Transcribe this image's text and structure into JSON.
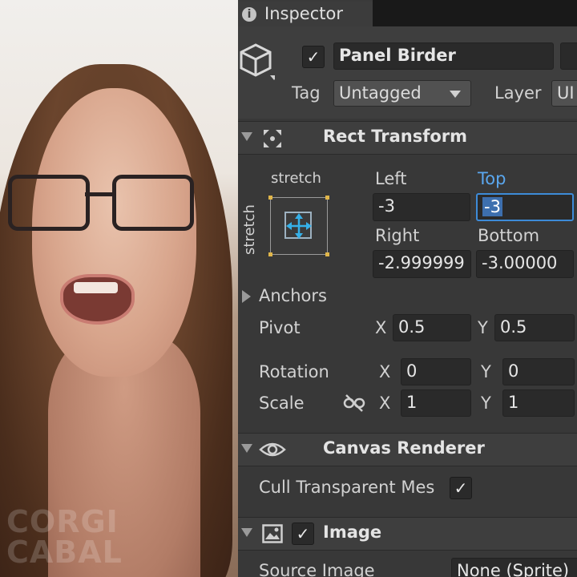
{
  "webcam": {
    "watermark_line1": "CORGI",
    "watermark_line2": "CABAL"
  },
  "inspector": {
    "tab_label": "Inspector",
    "gameobject": {
      "name": "Panel Birder",
      "active_checked": "✓",
      "tag_label": "Tag",
      "tag_value": "Untagged",
      "layer_label": "Layer",
      "layer_value": "UI"
    },
    "rect_transform": {
      "title": "Rect Transform",
      "stretch_h": "stretch",
      "stretch_v": "stretch",
      "left_label": "Left",
      "left_value": "-3",
      "top_label": "Top",
      "top_value": "-3",
      "right_label": "Right",
      "right_value": "-2.999999",
      "bottom_label": "Bottom",
      "bottom_value": "-3.00000",
      "anchors_label": "Anchors",
      "pivot_label": "Pivot",
      "pivot_x_label": "X",
      "pivot_x": "0.5",
      "pivot_y_label": "Y",
      "pivot_y": "0.5",
      "rotation_label": "Rotation",
      "rot_x_label": "X",
      "rot_x": "0",
      "rot_y_label": "Y",
      "rot_y": "0",
      "scale_label": "Scale",
      "scale_x_label": "X",
      "scale_x": "1",
      "scale_y_label": "Y",
      "scale_y": "1"
    },
    "canvas_renderer": {
      "title": "Canvas Renderer",
      "cull_label": "Cull Transparent Mes",
      "cull_checked": "✓"
    },
    "image": {
      "title": "Image",
      "enabled_checked": "✓",
      "source_label": "Source Image",
      "source_value": "None (Sprite)"
    },
    "colors": {
      "highlight": "#3d8bd8",
      "panel": "#383838",
      "field": "#2a2a2a"
    }
  }
}
